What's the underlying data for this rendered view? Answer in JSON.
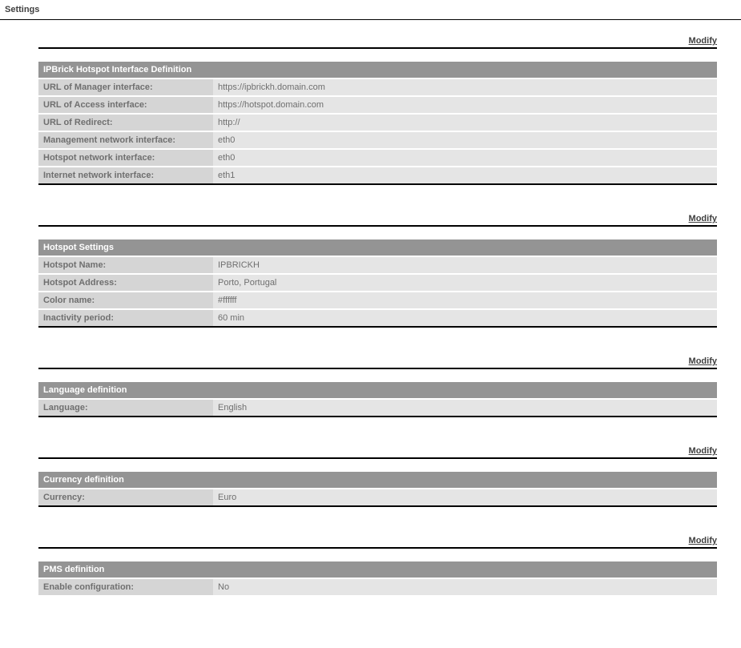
{
  "page": {
    "title": "Settings",
    "modify_label": "Modify"
  },
  "sections": {
    "interface": {
      "title": "IPBrick Hotspot Interface Definition",
      "rows": [
        {
          "label": "URL of Manager interface:",
          "value": "https://ipbrickh.domain.com"
        },
        {
          "label": "URL of Access interface:",
          "value": "https://hotspot.domain.com"
        },
        {
          "label": "URL of Redirect:",
          "value": "http://"
        },
        {
          "label": "Management network interface:",
          "value": "eth0"
        },
        {
          "label": "Hotspot network interface:",
          "value": "eth0"
        },
        {
          "label": "Internet network interface:",
          "value": "eth1"
        }
      ]
    },
    "hotspot": {
      "title": "Hotspot Settings",
      "rows": [
        {
          "label": "Hotspot Name:",
          "value": "IPBRICKH"
        },
        {
          "label": "Hotspot Address:",
          "value": "Porto, Portugal"
        },
        {
          "label": "Color name:",
          "value": "#ffffff"
        },
        {
          "label": "Inactivity period:",
          "value": "60 min"
        }
      ]
    },
    "language": {
      "title": "Language definition",
      "rows": [
        {
          "label": "Language:",
          "value": "English"
        }
      ]
    },
    "currency": {
      "title": "Currency definition",
      "rows": [
        {
          "label": "Currency:",
          "value": "Euro"
        }
      ]
    },
    "pms": {
      "title": "PMS definition",
      "rows": [
        {
          "label": "Enable configuration:",
          "value": "No"
        }
      ]
    }
  }
}
